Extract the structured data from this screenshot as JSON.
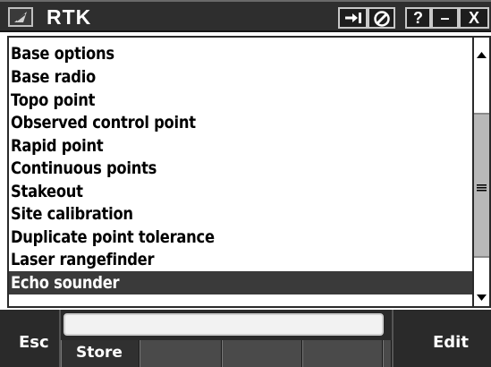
{
  "window": {
    "title": "RTK",
    "buttons": {
      "forward_icon": "arrow-right-icon",
      "stop_icon": "no-entry-icon",
      "help_label": "?",
      "minimize_label": "–",
      "close_label": "X"
    }
  },
  "list": {
    "items": [
      {
        "label": "Base options"
      },
      {
        "label": "Base radio"
      },
      {
        "label": "Topo point"
      },
      {
        "label": "Observed control point"
      },
      {
        "label": "Rapid point"
      },
      {
        "label": "Continuous points"
      },
      {
        "label": "Stakeout"
      },
      {
        "label": "Site calibration"
      },
      {
        "label": "Duplicate point tolerance"
      },
      {
        "label": "Laser rangefinder"
      },
      {
        "label": "Echo sounder"
      }
    ],
    "selected_index": 10
  },
  "softkeys": {
    "esc_label": "Esc",
    "store_label": "Store",
    "edit_label": "Edit"
  },
  "colors": {
    "titlebar_bg": "#2e2e2e",
    "selected_bg": "#3a3a3a",
    "softkey_bg": "#2a2a2a"
  }
}
